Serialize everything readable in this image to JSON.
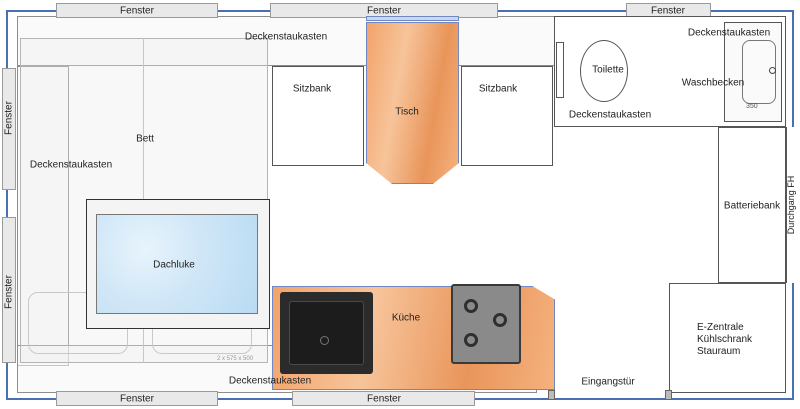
{
  "windows": {
    "top_left": "Fenster",
    "top_center": "Fenster",
    "top_right": "Fenster",
    "bottom_left": "Fenster",
    "bottom_center": "Fenster",
    "left_upper": "Fenster",
    "left_lower": "Fenster"
  },
  "labels": {
    "ceiling_top": "Deckenstaukasten",
    "ceiling_left": "Deckenstaukasten",
    "ceiling_bottom": "Deckenstaukasten",
    "ceiling_bath_top": "Deckenstaukasten",
    "ceiling_bath_bottom": "Deckenstaukasten",
    "bed": "Bett",
    "skylight": "Dachluke",
    "bench_left": "Sitzbank",
    "table": "Tisch",
    "bench_right": "Sitzbank",
    "toilet": "Toilette",
    "washbasin": "Waschbecken",
    "battery_bench": "Batteriebank",
    "passage": "Durchgang FH",
    "kitchen": "Küche",
    "utility_line1": "E-Zentrale",
    "utility_line2": "Kühlschrank",
    "utility_line3": "Stauraum",
    "entrance_door": "Eingangstür",
    "skylight_dims": "2 x 575 x 500",
    "basin_dim": "350"
  },
  "colors": {
    "outer_wall": "#4a6fb5",
    "wood": "#f2a36a",
    "skylight": "#cfe6f7",
    "sink": "#2b2b2b",
    "stove": "#8a8a8a"
  }
}
